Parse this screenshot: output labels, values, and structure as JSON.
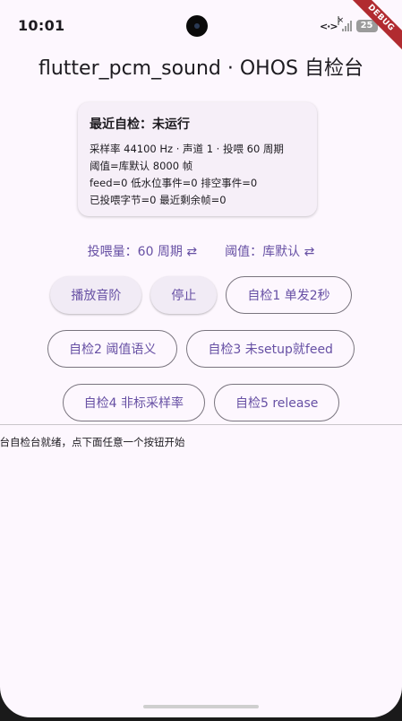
{
  "status_bar": {
    "time": "10:01",
    "network_icon": "<·>",
    "battery_level": "25",
    "debug_label": "DEBUG",
    "icons": [
      "camera-icon",
      "data-transfer-icon",
      "signal-icon",
      "battery-icon",
      "charging-bolt-icon"
    ]
  },
  "app": {
    "title": "flutter_pcm_sound · OHOS 自检台"
  },
  "status_card": {
    "title": "最近自检：未运行",
    "lines": [
      "采样率 44100 Hz · 声道 1 · 投喂 60 周期",
      "阈值=库默认 8000 帧",
      "feed=0  低水位事件=0  排空事件=0",
      "已投喂字节=0  最近剩余帧=0"
    ]
  },
  "toggles": {
    "feed_amount": "投喂量：60 周期 ⇄",
    "threshold": "阈值：库默认 ⇄"
  },
  "buttons": {
    "play_scale": "播放音阶",
    "stop": "停止",
    "test1": "自检1 单发2秒",
    "test2": "自检2 阈值语义",
    "test3": "自检3 未setup就feed",
    "test4": "自检4 非标采样率",
    "test5": "自检5 release"
  },
  "log": {
    "text": "平台自检台就绪，点下面任意一个按钮开始"
  },
  "colors": {
    "background": "#fdf7fe",
    "primary": "#6750a4",
    "card": "#f6eff8",
    "outline": "#79747e",
    "debug_banner": "#b12b30"
  }
}
